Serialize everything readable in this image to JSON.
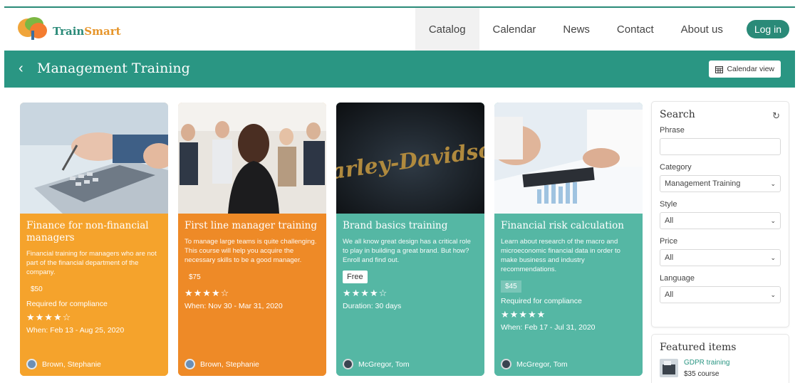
{
  "brand": {
    "name_part1": "Train",
    "name_part2": "Smart"
  },
  "nav": {
    "items": [
      "Catalog",
      "Calendar",
      "News",
      "Contact",
      "About us"
    ],
    "login": "Log in"
  },
  "banner": {
    "back": "‹",
    "title": "Management Training",
    "calendar_view": "Calendar view"
  },
  "cards": [
    {
      "title": "Finance for non-financial managers",
      "description": "Financial training for managers who are not part of the financial department of the company.",
      "price": "$50",
      "required": "Required for compliance",
      "stars": "★★★★☆",
      "when": "When: Feb 13 - Aug 25, 2020",
      "author": "Brown, Stephanie"
    },
    {
      "title": "First line manager training",
      "description": "To manage large teams is quite challenging. This course will help you acquire the necessary skills to be a good manager.",
      "price": "$75",
      "stars": "★★★★☆",
      "when": "When: Nov 30 - Mar 31, 2020",
      "author": "Brown, Stephanie"
    },
    {
      "title": "Brand basics training",
      "description": "We all know great design has a critical role to play in building a great brand. But how? Enroll and find out.",
      "price": "Free",
      "stars": "★★★★☆",
      "duration": "Duration: 30 days",
      "author": "McGregor, Tom",
      "image_text": "Harley-Davidson"
    },
    {
      "title": "Financial risk calculation",
      "description": "Learn about research of the macro and microeconomic financial data in order to make business and industry recommendations.",
      "price": "$45",
      "required": "Required for compliance",
      "stars": "★★★★★",
      "when": "When: Feb 17 - Jul 31, 2020",
      "author": "McGregor, Tom"
    }
  ],
  "search": {
    "title": "Search",
    "phrase_label": "Phrase",
    "phrase_value": "",
    "category_label": "Category",
    "category_value": "Management Training",
    "style_label": "Style",
    "style_value": "All",
    "price_label": "Price",
    "price_value": "All",
    "language_label": "Language",
    "language_value": "All"
  },
  "featured": {
    "title": "Featured items",
    "item_link": "GDPR training",
    "item_sub": "$35 course"
  },
  "colors": {
    "teal": "#2a9683",
    "orange": "#f5a32c",
    "orange_dark": "#ee8a27",
    "card_teal": "#55b7a4"
  },
  "icons": [
    "logo-tree-icon",
    "chevron-left-icon",
    "calendar-icon",
    "reset-icon",
    "star-icon",
    "avatar-icon",
    "chevron-down-icon"
  ]
}
